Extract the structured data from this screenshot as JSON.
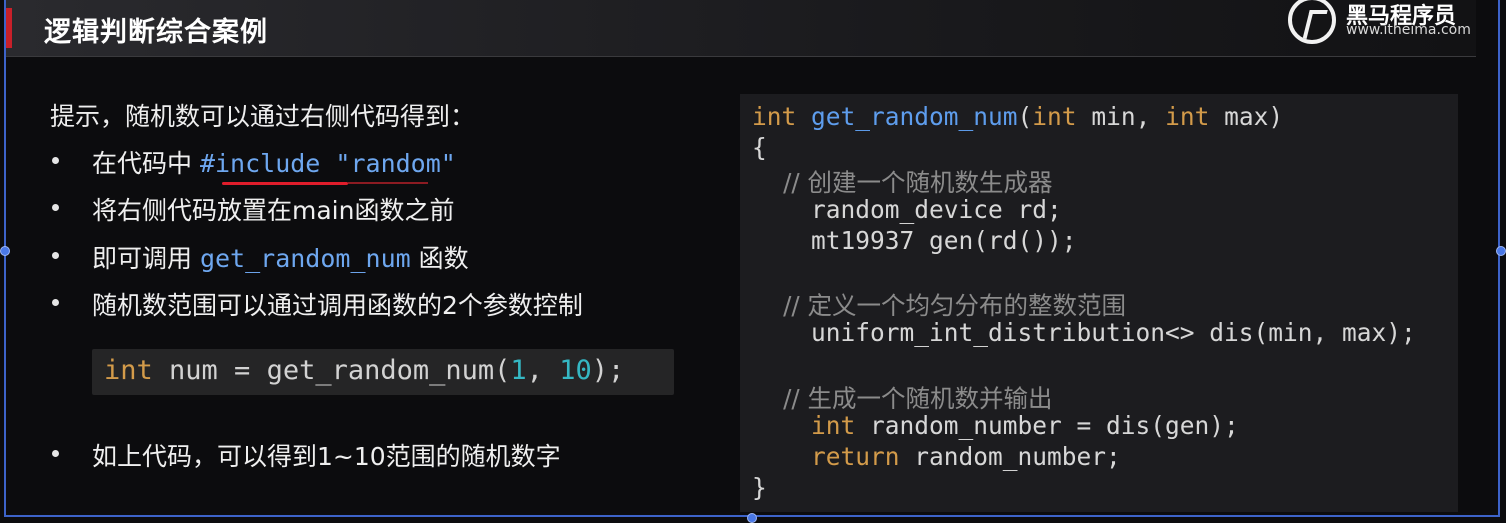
{
  "header": {
    "title": "逻辑判断综合案例",
    "logo_name": "黑马程序员",
    "logo_url": "www.itheima.com"
  },
  "colors": {
    "accent_red": "#c8202a",
    "keyword": "#d39b4a",
    "function": "#5e9ded",
    "number": "#35b8c4",
    "comment": "#8b8b8b",
    "frame_blue": "#3d63c9"
  },
  "left": {
    "hint": "提示，随机数可以通过右侧代码得到：",
    "bullets": [
      {
        "text": "在代码中 ",
        "code": "#include \"random\""
      },
      {
        "text": "将右侧代码放置在main函数之前"
      },
      {
        "text_before": "即可调用 ",
        "code": "get_random_num",
        "text_after": " 函数"
      },
      {
        "text": "随机数范围可以通过调用函数的2个参数控制"
      },
      {
        "text": "如上代码，可以得到1~10范围的随机数字"
      }
    ],
    "snippet": {
      "kw": "int",
      "rest": " num = get_random_num(",
      "n1": "1",
      "sep": ", ",
      "n2": "10",
      "end": ");"
    }
  },
  "code": {
    "l1_kw": "int",
    "l1_fn": " get_random_num",
    "l1_p1": "(",
    "l1_kw2": "int",
    "l1_p2": " min, ",
    "l1_kw3": "int",
    "l1_p3": " max)",
    "l2": "{",
    "l3": "    // 创建一个随机数生成器",
    "l4": "    random_device rd;",
    "l5": "    mt19937 gen(rd());",
    "l6": "    // 定义一个均匀分布的整数范围",
    "l7": "    uniform_int_distribution<> dis(min, max);",
    "l8": "    // 生成一个随机数并输出",
    "l9_kw": "    int",
    "l9_rest": " random_number = dis(gen);",
    "l10_kw": "    return",
    "l10_rest": " random_number;",
    "l11": "}"
  }
}
